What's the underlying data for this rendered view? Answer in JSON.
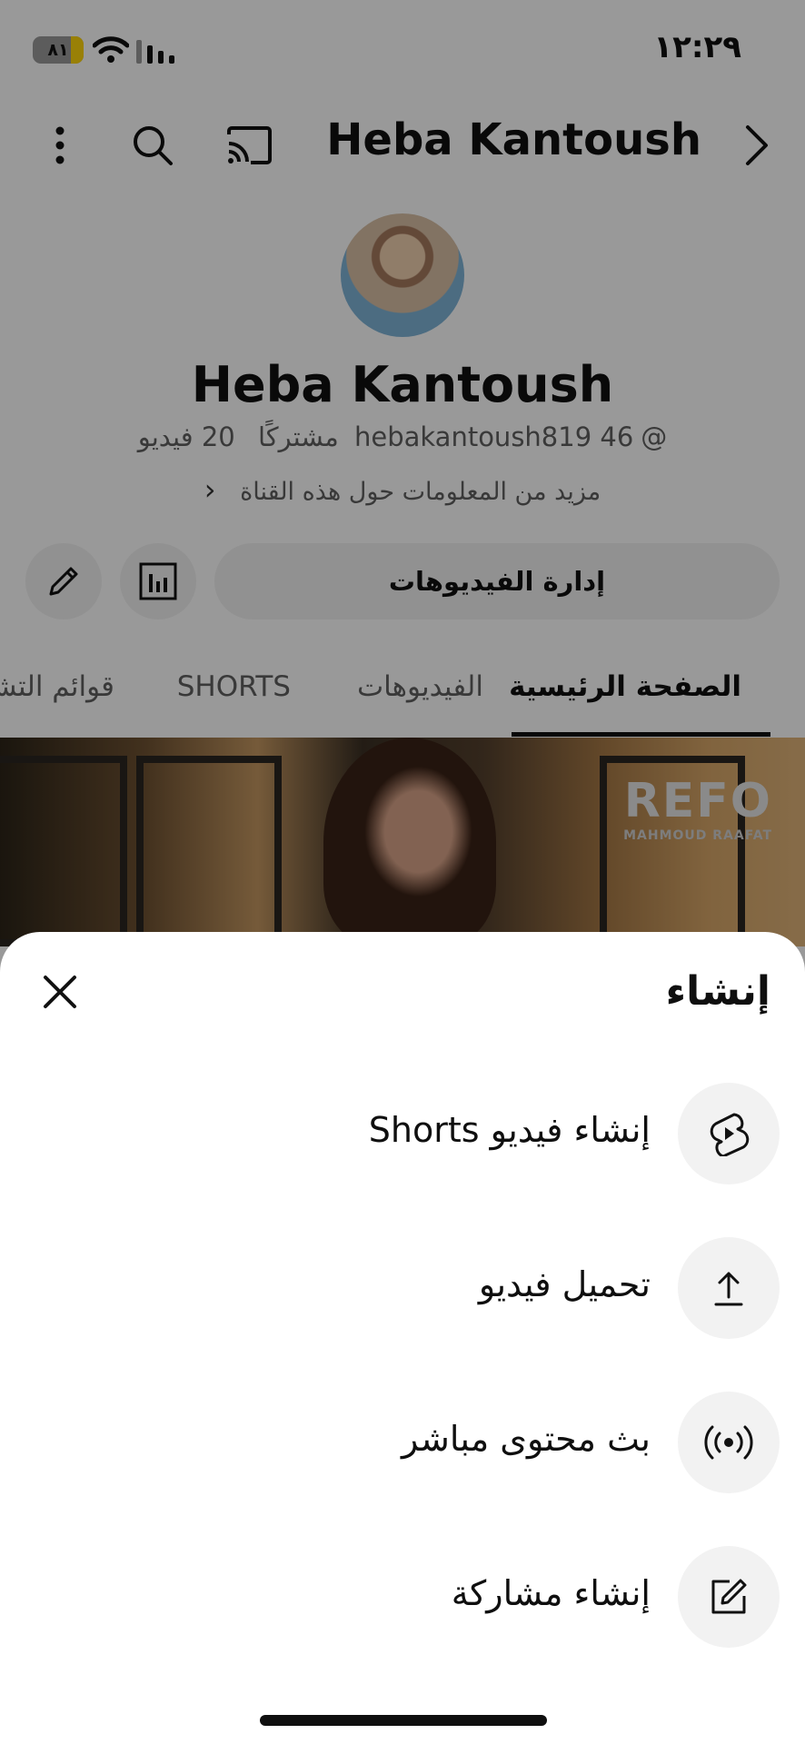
{
  "status_bar": {
    "time": "١٢:٢٩",
    "battery": "٨١",
    "battery_level": 0.25
  },
  "header": {
    "channel_name": "Heba Kantoush"
  },
  "profile": {
    "name": "Heba Kantoush",
    "handle": "@hebakantoush819",
    "subscribers": "46 مشتركًا",
    "videos": "20 فيديو",
    "more_info": "مزيد من المعلومات حول هذه القناة"
  },
  "actions": {
    "manage_videos": "إدارة الفيديوهات"
  },
  "tabs": [
    {
      "label": "الصفحة الرئيسية",
      "active": true
    },
    {
      "label": "الفيديوهات",
      "active": false
    },
    {
      "label": "SHORTS",
      "active": false
    },
    {
      "label": "قوائم التشغيل",
      "active": false
    }
  ],
  "banner": {
    "logo": "REFO",
    "logo_sub": "MAHMOUD RAAFAT"
  },
  "sheet": {
    "title": "إنشاء",
    "options": [
      {
        "label": "إنشاء فيديو Shorts",
        "icon": "shorts-icon"
      },
      {
        "label": "تحميل فيديو",
        "icon": "upload-icon"
      },
      {
        "label": "بث محتوى مباشر",
        "icon": "live-icon"
      },
      {
        "label": "إنشاء مشاركة",
        "icon": "create-post-icon"
      }
    ]
  },
  "colors": {
    "scrim": "#000000",
    "sheet_bg": "#ffffff",
    "icon_circle": "#f2f2f2",
    "battery_fill": "#ffd60a"
  }
}
